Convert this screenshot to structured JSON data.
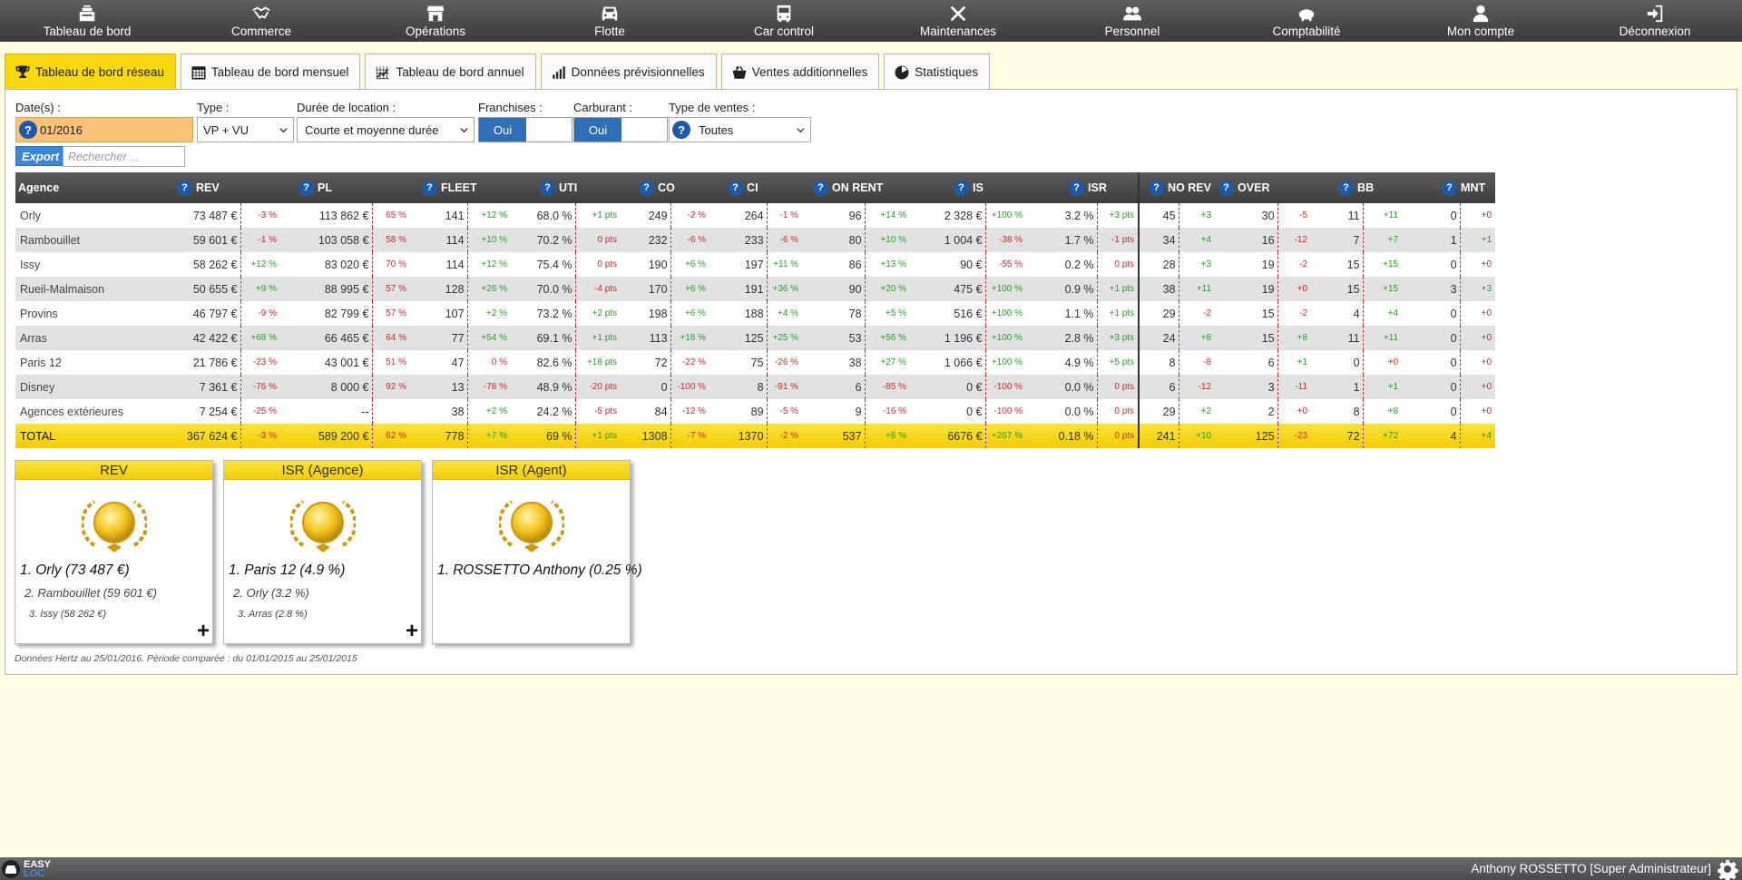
{
  "nav": [
    {
      "label": "Tableau de bord",
      "icon": "dashboard-icon"
    },
    {
      "label": "Commerce",
      "icon": "handshake-icon"
    },
    {
      "label": "Opérations",
      "icon": "store-icon"
    },
    {
      "label": "Flotte",
      "icon": "car-icon"
    },
    {
      "label": "Car control",
      "icon": "bus-icon"
    },
    {
      "label": "Maintenances",
      "icon": "tools-icon"
    },
    {
      "label": "Personnel",
      "icon": "users-icon"
    },
    {
      "label": "Comptabilité",
      "icon": "piggy-bank-icon"
    },
    {
      "label": "Mon compte",
      "icon": "user-icon"
    },
    {
      "label": "Déconnexion",
      "icon": "logout-icon"
    }
  ],
  "tabs": [
    {
      "label": "Tableau de bord réseau",
      "icon": "trophy-icon",
      "active": true
    },
    {
      "label": "Tableau de bord mensuel",
      "icon": "calendar-icon"
    },
    {
      "label": "Tableau de bord annuel",
      "icon": "chart-grid-icon"
    },
    {
      "label": "Données prévisionnelles",
      "icon": "bar-signal-icon"
    },
    {
      "label": "Ventes additionnelles",
      "icon": "basket-icon"
    },
    {
      "label": "Statistiques",
      "icon": "pie-icon"
    }
  ],
  "filters": {
    "date_label": "Date(s) :",
    "date_value": "01/2016",
    "type_label": "Type :",
    "type_value": "VP + VU",
    "duree_label": "Durée de location :",
    "duree_value": "Courte et moyenne durée",
    "franchises_label": "Franchises :",
    "franchises_value": "Oui",
    "carburant_label": "Carburant :",
    "carburant_value": "Oui",
    "ventes_label": "Type de ventes :",
    "ventes_value": "Toutes",
    "help_glyph": "?"
  },
  "export_label": "Export",
  "search_placeholder": "Rechercher ...",
  "table": {
    "agency_header": "Agence",
    "metrics": [
      "REV",
      "PL",
      "FLEET",
      "UTI",
      "CO",
      "CI",
      "ON RENT",
      "IS",
      "ISR",
      "NO REV",
      "OVER",
      "BB",
      "MNT"
    ],
    "rows": [
      {
        "agency": "Orly",
        "cells": [
          [
            "73 487 €",
            "-3 %"
          ],
          [
            "113 862 €",
            "65 %"
          ],
          [
            "141",
            "+12 %"
          ],
          [
            "68.0 %",
            "+1 pts"
          ],
          [
            "249",
            "-2 %"
          ],
          [
            "264",
            "-1 %"
          ],
          [
            "96",
            "+14 %"
          ],
          [
            "2 328 €",
            "+100 %"
          ],
          [
            "3.2 %",
            "+3 pts"
          ],
          [
            "45",
            "+3"
          ],
          [
            "30",
            "-5"
          ],
          [
            "11",
            "+11"
          ],
          [
            "0",
            "+0"
          ]
        ]
      },
      {
        "agency": "Rambouillet",
        "cells": [
          [
            "59 601 €",
            "-1 %"
          ],
          [
            "103 058 €",
            "58 %"
          ],
          [
            "114",
            "+10 %"
          ],
          [
            "70.2 %",
            "0 pts"
          ],
          [
            "232",
            "-6 %"
          ],
          [
            "233",
            "-6 %"
          ],
          [
            "80",
            "+10 %"
          ],
          [
            "1 004 €",
            "-38 %"
          ],
          [
            "1.7 %",
            "-1 pts"
          ],
          [
            "34",
            "+4"
          ],
          [
            "16",
            "-12"
          ],
          [
            "7",
            "+7"
          ],
          [
            "1",
            "+1"
          ]
        ]
      },
      {
        "agency": "Issy",
        "cells": [
          [
            "58 262 €",
            "+12 %"
          ],
          [
            "83 020 €",
            "70 %"
          ],
          [
            "114",
            "+12 %"
          ],
          [
            "75.4 %",
            "0 pts"
          ],
          [
            "190",
            "+6 %"
          ],
          [
            "197",
            "+11 %"
          ],
          [
            "86",
            "+13 %"
          ],
          [
            "90 €",
            "-55 %"
          ],
          [
            "0.2 %",
            "0 pts"
          ],
          [
            "28",
            "+3"
          ],
          [
            "19",
            "-2"
          ],
          [
            "15",
            "+15"
          ],
          [
            "0",
            "+0"
          ]
        ]
      },
      {
        "agency": "Rueil-Malmaison",
        "cells": [
          [
            "50 655 €",
            "+9 %"
          ],
          [
            "88 995 €",
            "57 %"
          ],
          [
            "128",
            "+26 %"
          ],
          [
            "70.0 %",
            "-4 pts"
          ],
          [
            "170",
            "+6 %"
          ],
          [
            "191",
            "+36 %"
          ],
          [
            "90",
            "+20 %"
          ],
          [
            "475 €",
            "+100 %"
          ],
          [
            "0.9 %",
            "+1 pts"
          ],
          [
            "38",
            "+11"
          ],
          [
            "19",
            "+0"
          ],
          [
            "15",
            "+15"
          ],
          [
            "3",
            "+3"
          ]
        ]
      },
      {
        "agency": "Provins",
        "cells": [
          [
            "46 797 €",
            "-9 %"
          ],
          [
            "82 799 €",
            "57 %"
          ],
          [
            "107",
            "+2 %"
          ],
          [
            "73.2 %",
            "+2 pts"
          ],
          [
            "198",
            "+6 %"
          ],
          [
            "188",
            "+4 %"
          ],
          [
            "78",
            "+5 %"
          ],
          [
            "516 €",
            "+100 %"
          ],
          [
            "1.1 %",
            "+1 pts"
          ],
          [
            "29",
            "-2"
          ],
          [
            "15",
            "-2"
          ],
          [
            "4",
            "+4"
          ],
          [
            "0",
            "+0"
          ]
        ]
      },
      {
        "agency": "Arras",
        "cells": [
          [
            "42 422 €",
            "+68 %"
          ],
          [
            "66 465 €",
            "64 %"
          ],
          [
            "77",
            "+54 %"
          ],
          [
            "69.1 %",
            "+1 pts"
          ],
          [
            "113",
            "+18 %"
          ],
          [
            "125",
            "+25 %"
          ],
          [
            "53",
            "+56 %"
          ],
          [
            "1 196 €",
            "+100 %"
          ],
          [
            "2.8 %",
            "+3 pts"
          ],
          [
            "24",
            "+8"
          ],
          [
            "15",
            "+8"
          ],
          [
            "11",
            "+11"
          ],
          [
            "0",
            "+0"
          ]
        ]
      },
      {
        "agency": "Paris 12",
        "cells": [
          [
            "21 786 €",
            "-23 %"
          ],
          [
            "43 001 €",
            "51 %"
          ],
          [
            "47",
            "0 %"
          ],
          [
            "82.6 %",
            "+18 pts"
          ],
          [
            "72",
            "-22 %"
          ],
          [
            "75",
            "-26 %"
          ],
          [
            "38",
            "+27 %"
          ],
          [
            "1 066 €",
            "+100 %"
          ],
          [
            "4.9 %",
            "+5 pts"
          ],
          [
            "8",
            "-8"
          ],
          [
            "6",
            "+1"
          ],
          [
            "0",
            "+0"
          ],
          [
            "0",
            "+0"
          ]
        ]
      },
      {
        "agency": "Disney",
        "cells": [
          [
            "7 361 €",
            "-76 %"
          ],
          [
            "8 000 €",
            "92 %"
          ],
          [
            "13",
            "-78 %"
          ],
          [
            "48.9 %",
            "-20 pts"
          ],
          [
            "0",
            "-100 %"
          ],
          [
            "8",
            "-91 %"
          ],
          [
            "6",
            "-85 %"
          ],
          [
            "0 €",
            "-100 %"
          ],
          [
            "0.0 %",
            "0 pts"
          ],
          [
            "6",
            "-12"
          ],
          [
            "3",
            "-11"
          ],
          [
            "1",
            "+1"
          ],
          [
            "0",
            "+0"
          ]
        ]
      },
      {
        "agency": "Agences extérieures",
        "cells": [
          [
            "7 254 €",
            "-25 %"
          ],
          [
            "--",
            ""
          ],
          [
            "38",
            "+2 %"
          ],
          [
            "24.2 %",
            "-5 pts"
          ],
          [
            "84",
            "-12 %"
          ],
          [
            "89",
            "-5 %"
          ],
          [
            "9",
            "-16 %"
          ],
          [
            "0 €",
            "-100 %"
          ],
          [
            "0.0 %",
            "0 pts"
          ],
          [
            "29",
            "+2"
          ],
          [
            "2",
            "+0"
          ],
          [
            "8",
            "+8"
          ],
          [
            "0",
            "+0"
          ]
        ]
      }
    ],
    "total": {
      "agency": "TOTAL",
      "cells": [
        [
          "367 624 €",
          "-3 %"
        ],
        [
          "589 200 €",
          "62 %"
        ],
        [
          "778",
          "+7 %"
        ],
        [
          "69 %",
          "+1 pts"
        ],
        [
          "1308",
          "-7 %"
        ],
        [
          "1370",
          "-2 %"
        ],
        [
          "537",
          "+8 %"
        ],
        [
          "6676 €",
          "+267 %"
        ],
        [
          "0.18 %",
          "0 pts"
        ],
        [
          "241",
          "+10"
        ],
        [
          "125",
          "-23"
        ],
        [
          "72",
          "+72"
        ],
        [
          "4",
          "+4"
        ]
      ]
    }
  },
  "podiums": [
    {
      "title": "REV",
      "first": "1. Orly (73 487 €)",
      "second": "2. Rambouillet (59 601 €)",
      "third": "3. Issy (58 262 €)",
      "more": "+"
    },
    {
      "title": "ISR (Agence)",
      "first": "1. Paris 12 (4.9 %)",
      "second": "2. Orly (3.2 %)",
      "third": "3. Arras (2.8 %)",
      "more": "+"
    },
    {
      "title": "ISR (Agent)",
      "first": "1. ROSSETTO Anthony (0.25 %)",
      "second": "",
      "third": ""
    }
  ],
  "footnote": "Données Hertz au 25/01/2016. Période comparée : du 01/01/2015 au 25/01/2015",
  "footer": {
    "logo_line1": "EASY",
    "logo_line2": "LOC",
    "user": "Anthony ROSSETTO [Super Administrateur]"
  },
  "colors": {
    "active_tab": "#f8d90f",
    "positive": "#2a9c2a",
    "negative": "#d02a2a",
    "help": "#1f5aa6",
    "toggle_on": "#2e6fb5"
  }
}
